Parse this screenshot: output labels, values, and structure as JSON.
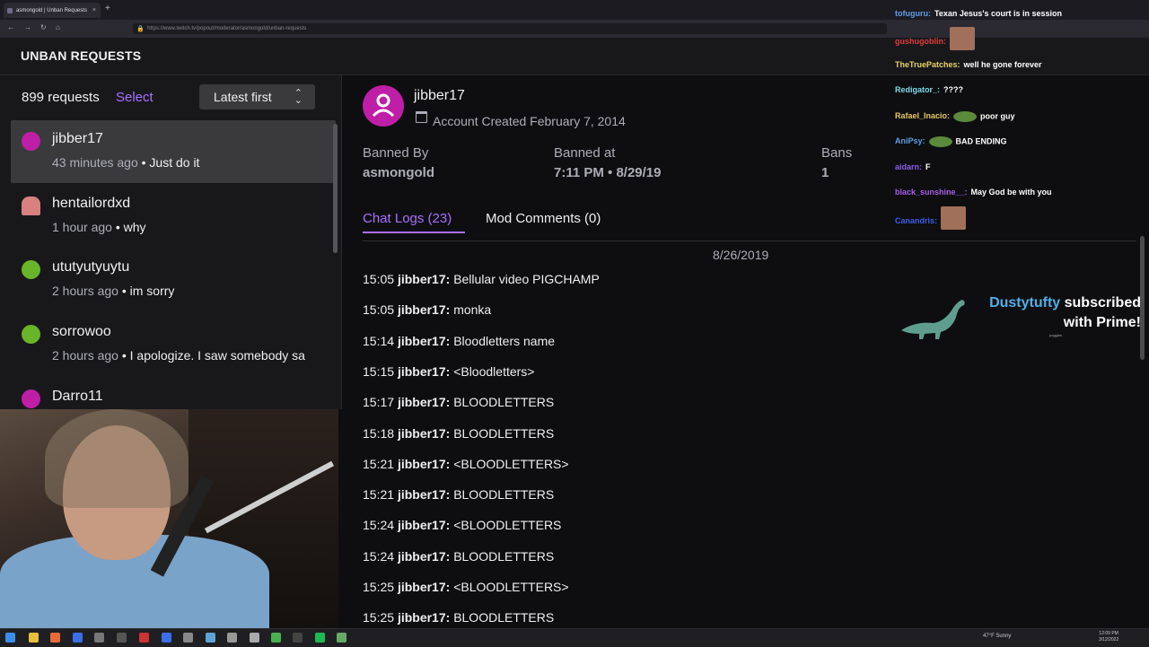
{
  "browser": {
    "tab_title": "asmongold | Unban Requests",
    "tab_close": "×",
    "new_tab": "+",
    "url": "https://www.twitch.tv/popout/moderator/asmongold/unban-requests"
  },
  "header": {
    "title": "UNBAN REQUESTS"
  },
  "list": {
    "count": "899 requests",
    "select_label": "Select",
    "sort_label": "Latest first",
    "sort_chevron": "⌃⌄",
    "items": [
      {
        "name": "jibber17",
        "ago": "43 minutes ago",
        "sep": " • ",
        "message": "Just do it",
        "avatar_color": "#bf1fa6",
        "avatar_icon": "user-icon"
      },
      {
        "name": "hentailordxd",
        "ago": "1 hour ago",
        "sep": " • ",
        "message": "why",
        "avatar_color": "#d98080",
        "avatar_icon": "anime-avatar"
      },
      {
        "name": "ututyutyuytu",
        "ago": "2 hours ago",
        "sep": " • ",
        "message": "im sorry",
        "avatar_color": "#69b52a",
        "avatar_icon": "user-icon"
      },
      {
        "name": "sorrowoo",
        "ago": "2 hours ago",
        "sep": " • ",
        "message": "I apologize. I saw somebody sa",
        "avatar_color": "#69b52a",
        "avatar_icon": "user-icon"
      },
      {
        "name": "Darro11",
        "ago": "",
        "sep": "",
        "message": "",
        "avatar_color": "#bf1fa6",
        "avatar_icon": "user-icon"
      }
    ]
  },
  "detail": {
    "username": "jibber17",
    "created": "Account Created February 7, 2014",
    "banned_by_label": "Banned By",
    "banned_by": "asmongold",
    "banned_at_label": "Banned at",
    "banned_at": "7:11 PM • 8/29/19",
    "bans_label": "Bans",
    "bans": "1",
    "tab_chat": "Chat Logs (23)",
    "tab_mod": "Mod Comments (0)",
    "date": "8/26/2019",
    "messages": [
      {
        "time": "15:05",
        "user": "jibber17:",
        "text": "Bellular video PIGCHAMP"
      },
      {
        "time": "15:05",
        "user": "jibber17:",
        "text": "monka"
      },
      {
        "time": "15:14",
        "user": "jibber17:",
        "text": "Bloodletters name"
      },
      {
        "time": "15:15",
        "user": "jibber17:",
        "text": "<Bloodletters>"
      },
      {
        "time": "15:17",
        "user": "jibber17:",
        "text": "BLOODLETTERS"
      },
      {
        "time": "15:18",
        "user": "jibber17:",
        "text": "BLOODLETTERS"
      },
      {
        "time": "15:21",
        "user": "jibber17:",
        "text": "<BLOODLETTERS>"
      },
      {
        "time": "15:21",
        "user": "jibber17:",
        "text": "BLOODLETTERS"
      },
      {
        "time": "15:24",
        "user": "jibber17:",
        "text": "<BLOODLETTERS"
      },
      {
        "time": "15:24",
        "user": "jibber17:",
        "text": "BLOODLETTERS"
      },
      {
        "time": "15:25",
        "user": "jibber17:",
        "text": "<BLOODLETTERS>"
      },
      {
        "time": "15:25",
        "user": "jibber17:",
        "text": "BLOODLETTERS"
      }
    ]
  },
  "overlay": {
    "chat": [
      {
        "user": "tofuguru:",
        "color": "#5f9ee8",
        "text": "Texan Jesus's court is in session",
        "emote": ""
      },
      {
        "user": "gushugoblin:",
        "color": "#e03c3c",
        "text": "",
        "emote": "face"
      },
      {
        "user": "TheTruePatches:",
        "color": "#e8d55f",
        "text": "well he gone forever",
        "emote": ""
      },
      {
        "user": "Redigator_:",
        "color": "#7fd8e8",
        "text": "????",
        "emote": ""
      },
      {
        "user": "Rafael_Inacio:",
        "color": "#e8c85f",
        "text": "poor guy",
        "emote": "pepe"
      },
      {
        "user": "AniPsy:",
        "color": "#5f9ee8",
        "text": "BAD ENDING",
        "emote": "pepe"
      },
      {
        "user": "aidarn:",
        "color": "#8a5fe8",
        "text": "F",
        "emote": ""
      },
      {
        "user": "black_sunshine__:",
        "color": "#a85fe8",
        "text": "May God be with you",
        "emote": ""
      },
      {
        "user": "Canandris:",
        "color": "#3c5fe8",
        "text": "",
        "emote": "face"
      }
    ],
    "sub_name": "Dustytufty",
    "sub_text1": " subscribed",
    "sub_text2": "with Prime!",
    "sub_small": "poggies"
  },
  "taskbar": {
    "weather": "47°F  Sunny",
    "time": "12:09 PM",
    "date": "3/12/2022"
  }
}
